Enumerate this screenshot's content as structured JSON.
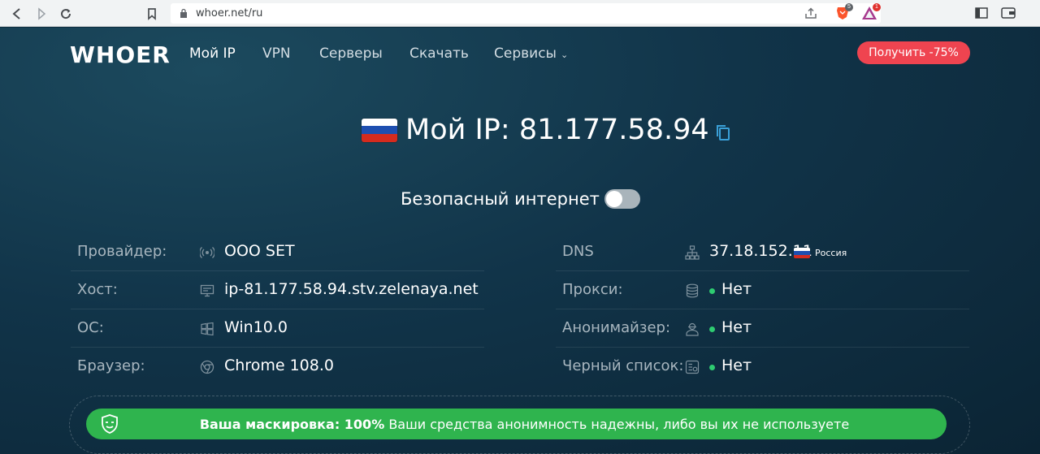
{
  "browser": {
    "url": "whoer.net/ru",
    "ext_brave_badge": "5",
    "ext_alert_badge": "1"
  },
  "header": {
    "logo": "WHOER",
    "nav": [
      "Мой IP",
      "VPN",
      "Серверы",
      "Скачать",
      "Сервисы"
    ],
    "promo_button": "Получить -75%"
  },
  "ip": {
    "label": "Мой IP: 81.177.58.94",
    "country_flag": [
      "#ffffff",
      "#1e4fb0",
      "#d52b1e"
    ]
  },
  "safe_internet": {
    "label": "Безопасный интернет",
    "enabled": false
  },
  "info_left": [
    {
      "label": "Провайдер:",
      "value": "OOO SET",
      "icon": "antenna-icon"
    },
    {
      "label": "Хост:",
      "value": "ip-81.177.58.94.stv.zelenaya.net",
      "icon": "monitor-icon"
    },
    {
      "label": "ОС:",
      "value": "Win10.0",
      "icon": "windows-icon"
    },
    {
      "label": "Браузер:",
      "value": "Chrome 108.0",
      "icon": "chrome-icon"
    }
  ],
  "info_right": [
    {
      "label": "DNS",
      "value": "37.18.152.11",
      "country": "Россия",
      "icon": "network-icon"
    },
    {
      "label": "Прокси:",
      "value": "Нет",
      "icon": "database-icon"
    },
    {
      "label": "Анонимайзер:",
      "value": "Нет",
      "icon": "incognito-icon"
    },
    {
      "label": "Черный список:",
      "value": "Нет",
      "icon": "blacklist-icon"
    }
  ],
  "mask": {
    "title": "Ваша маскировка: 100%",
    "text": "Ваши средства анонимность надежны, либо вы их не используете"
  },
  "colors": {
    "accent_red": "#ef4450",
    "ok_green": "#2fb44e",
    "page_bg": "#113449"
  }
}
